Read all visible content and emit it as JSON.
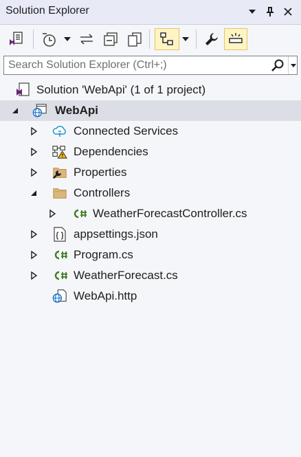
{
  "window": {
    "title": "Solution Explorer",
    "icons": [
      "dropdown-arrow-icon",
      "pin-icon",
      "close-icon"
    ]
  },
  "toolbar": {
    "items": [
      {
        "name": "switch-views-icon",
        "active": false
      },
      {
        "name": "history-icon",
        "active": false
      },
      {
        "name": "dropdown-icon",
        "active": false
      },
      {
        "name": "sync-icon",
        "active": false
      },
      {
        "name": "collapse-all-icon",
        "active": false
      },
      {
        "name": "show-all-files-icon",
        "active": false
      },
      {
        "name": "class-view-icon",
        "active": true
      },
      {
        "name": "dropdown-icon",
        "active": false
      },
      {
        "name": "properties-wrench-icon",
        "active": false
      },
      {
        "name": "preview-selected-icon",
        "active": true
      }
    ]
  },
  "search": {
    "placeholder": "Search Solution Explorer (Ctrl+;)",
    "value": ""
  },
  "tree": {
    "solution": "Solution 'WebApi' (1 of 1 project)",
    "project": "WebApi",
    "items": [
      {
        "label": "Connected Services",
        "icon": "connected-services-icon",
        "expander": "collapsed"
      },
      {
        "label": "Dependencies",
        "icon": "dependencies-warning-icon",
        "expander": "collapsed"
      },
      {
        "label": "Properties",
        "icon": "properties-folder-icon",
        "expander": "collapsed"
      },
      {
        "label": "Controllers",
        "icon": "folder-icon",
        "expander": "expanded"
      },
      {
        "label": "WeatherForecastController.cs",
        "icon": "csharp-file-icon",
        "expander": "collapsed"
      },
      {
        "label": "appsettings.json",
        "icon": "json-file-icon",
        "expander": "collapsed"
      },
      {
        "label": "Program.cs",
        "icon": "csharp-file-icon",
        "expander": "collapsed"
      },
      {
        "label": "WeatherForecast.cs",
        "icon": "csharp-file-icon",
        "expander": "collapsed"
      },
      {
        "label": "WebApi.http",
        "icon": "http-file-icon",
        "expander": "none"
      }
    ]
  },
  "colors": {
    "accent": "#68217a",
    "selection": "#dcdee6",
    "active_button": "#fff4c4",
    "csharp_green": "#3e7d24",
    "folder": "#dcb67a"
  }
}
